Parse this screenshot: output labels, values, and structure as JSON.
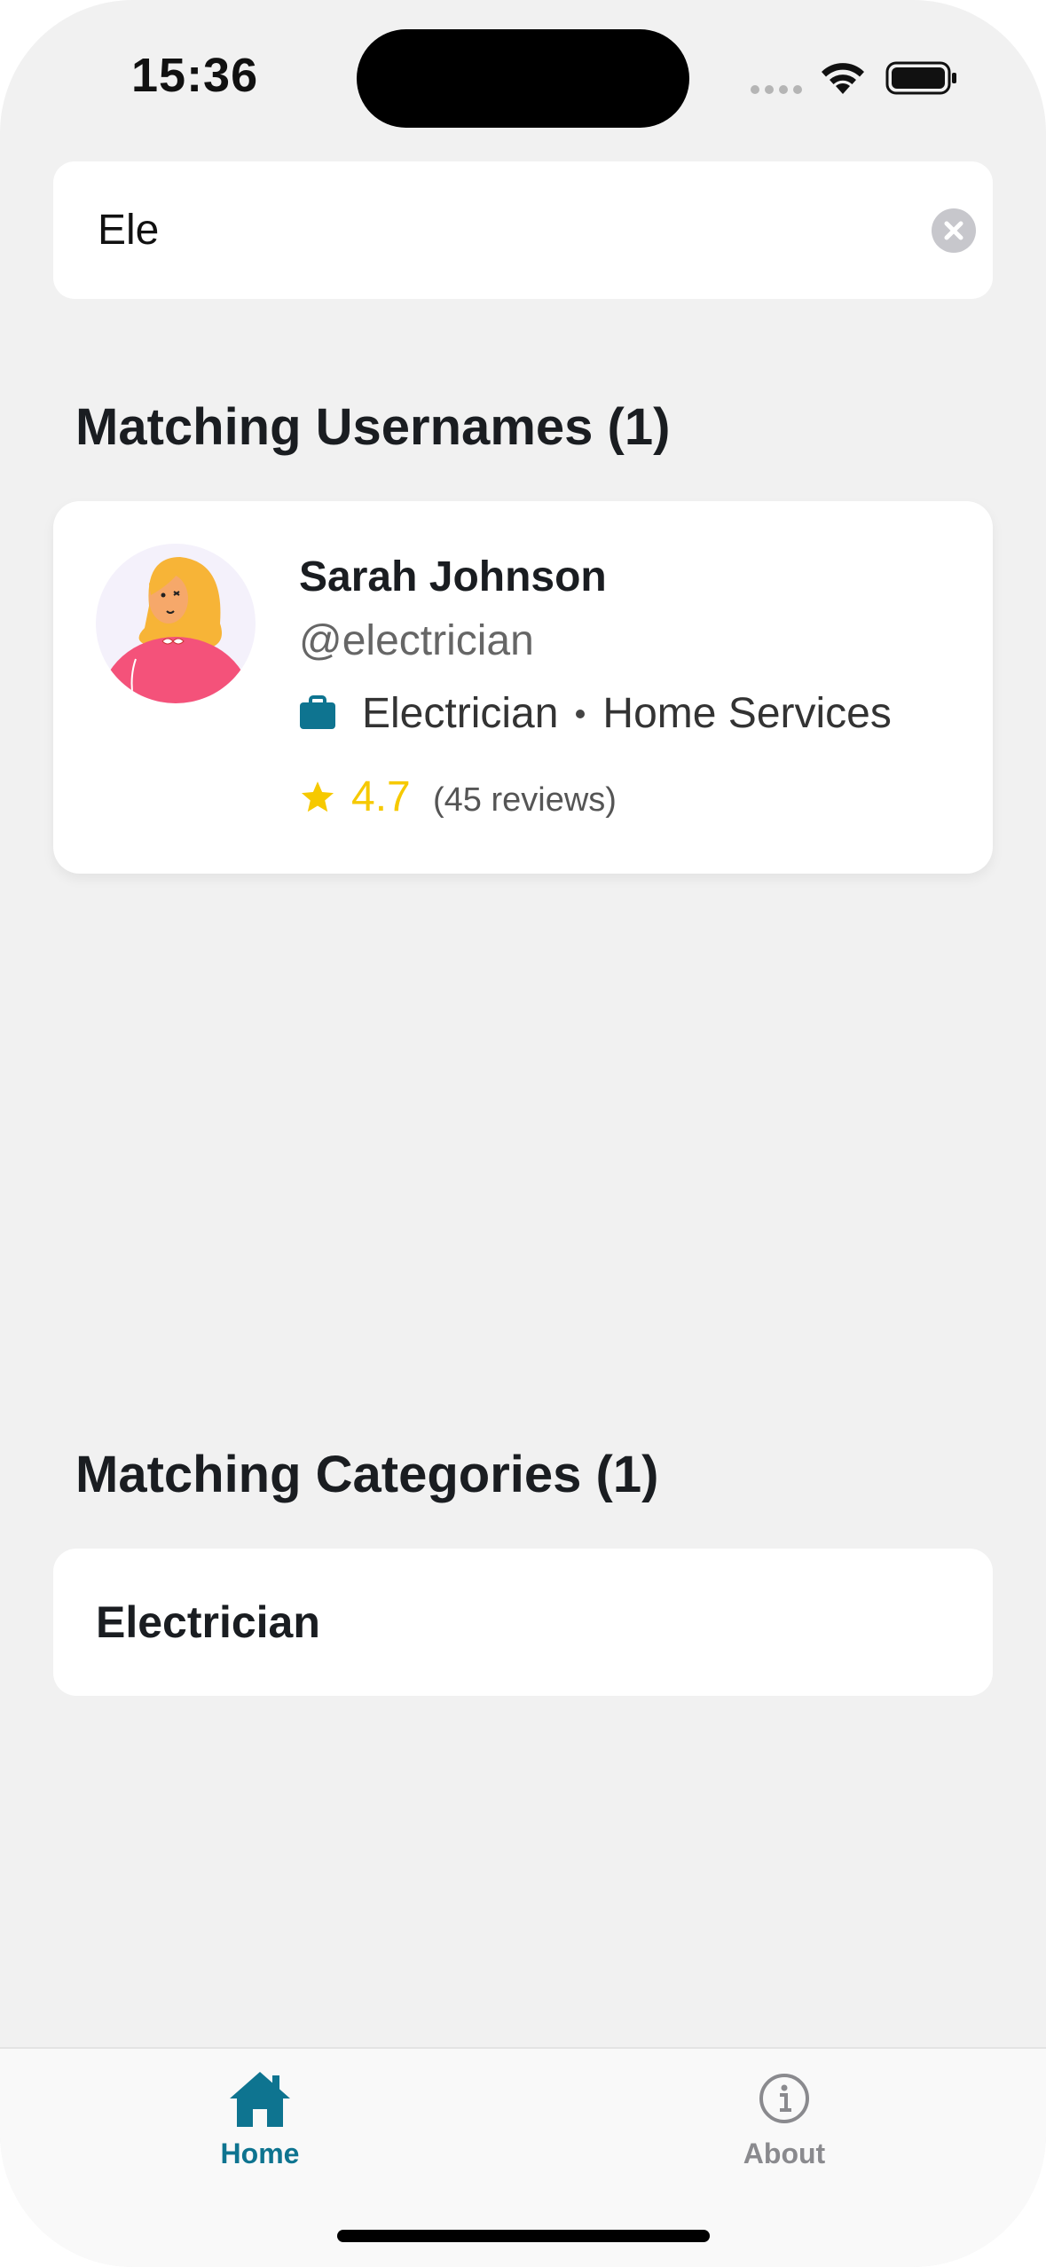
{
  "status_bar": {
    "time": "15:36"
  },
  "search": {
    "value": "Ele"
  },
  "users_section": {
    "title": "Matching Usernames (1)"
  },
  "users": [
    {
      "name": "Sarah Johnson",
      "handle": "@electrician",
      "profession": "Electrician",
      "category": "Home Services",
      "rating": "4.7",
      "reviews": "(45 reviews)"
    }
  ],
  "categories_section": {
    "title": "Matching Categories (1)"
  },
  "categories": [
    {
      "label": "Electrician"
    }
  ],
  "tabs": [
    {
      "label": "Home",
      "icon": "home-icon",
      "active": true
    },
    {
      "label": "About",
      "icon": "info-icon",
      "active": false
    }
  ],
  "colors": {
    "accent": "#0e7490",
    "star": "#f6c900",
    "background": "#f1f1f1",
    "card": "#ffffff"
  }
}
